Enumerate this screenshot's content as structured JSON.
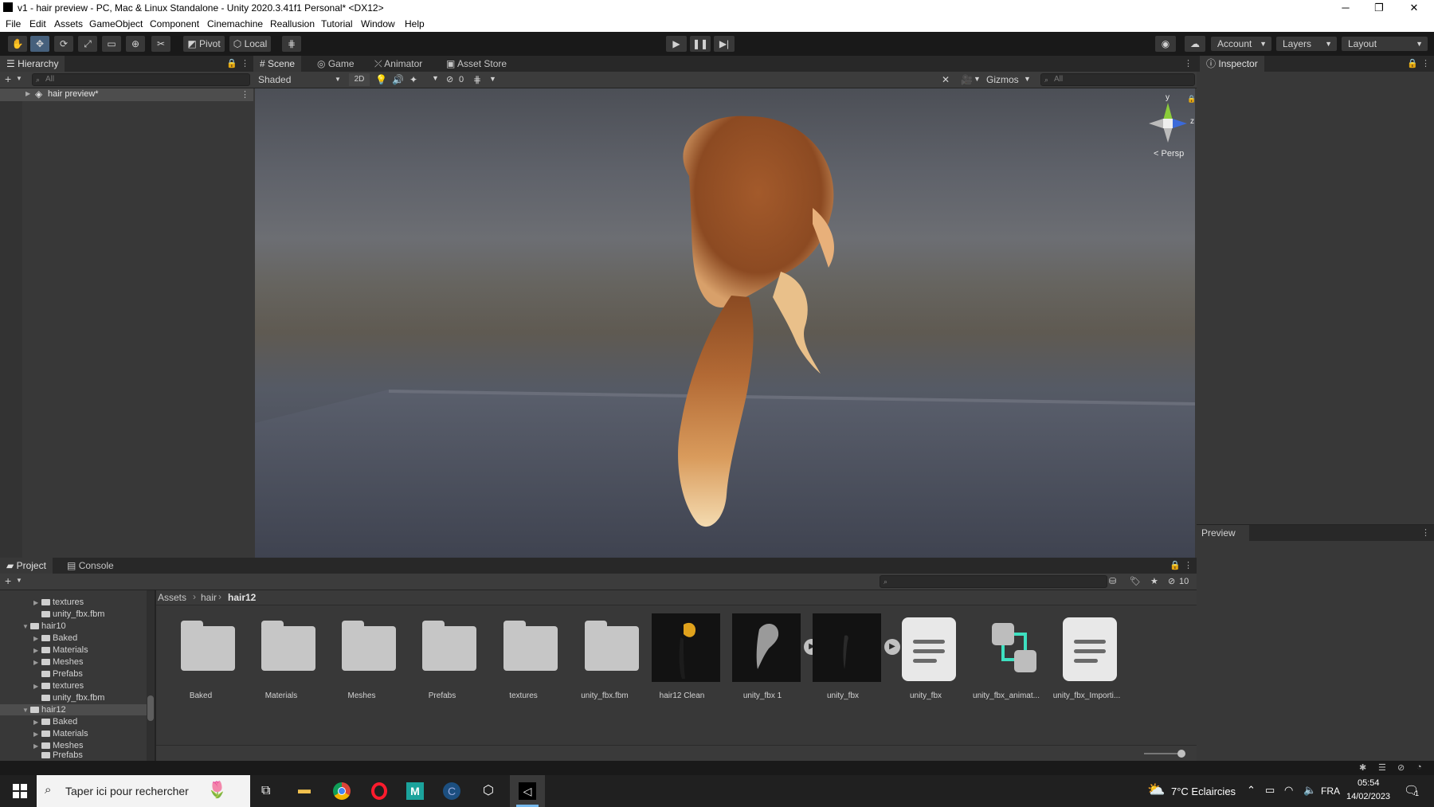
{
  "window": {
    "title": "v1 - hair preview - PC, Mac & Linux Standalone - Unity 2020.3.41f1 Personal* <DX12>",
    "minimize": "─",
    "restore": "❐",
    "close": "✕"
  },
  "menu": [
    "File",
    "Edit",
    "Assets",
    "GameObject",
    "Component",
    "Cinemachine",
    "Reallusion",
    "Tutorial",
    "Window",
    "Help"
  ],
  "toolbar": {
    "pivot_label": "Pivot",
    "local_label": "Local",
    "account_label": "Account",
    "layers_label": "Layers",
    "layout_label": "Layout"
  },
  "hierarchy": {
    "tab_label": "Hierarchy",
    "search_placeholder": "All",
    "root_item": "hair preview*"
  },
  "scene_tabs": {
    "scene": "Scene",
    "game": "Game",
    "animator": "Animator",
    "asset_store": "Asset Store"
  },
  "scene_toolbar": {
    "draw_mode": "Shaded",
    "mode_2d": "2D",
    "hidden_count": "0",
    "gizmos_label": "Gizmos",
    "search_placeholder": "All"
  },
  "gizmo": {
    "axis_y": "y",
    "axis_z": "z",
    "projection": "Persp"
  },
  "inspector": {
    "tab_label": "Inspector",
    "preview_label": "Preview"
  },
  "project": {
    "tab_project": "Project",
    "tab_console": "Console",
    "hidden_count": "10",
    "breadcrumb": [
      "Assets",
      "hair",
      "hair12"
    ],
    "tree": [
      {
        "label": "textures",
        "depth": 2,
        "arrow": true
      },
      {
        "label": "unity_fbx.fbm",
        "depth": 2,
        "arrow": false
      },
      {
        "label": "hair10",
        "depth": 1,
        "arrow": true,
        "open": true
      },
      {
        "label": "Baked",
        "depth": 2,
        "arrow": true
      },
      {
        "label": "Materials",
        "depth": 2,
        "arrow": true
      },
      {
        "label": "Meshes",
        "depth": 2,
        "arrow": true
      },
      {
        "label": "Prefabs",
        "depth": 2,
        "arrow": false
      },
      {
        "label": "textures",
        "depth": 2,
        "arrow": true
      },
      {
        "label": "unity_fbx.fbm",
        "depth": 2,
        "arrow": false
      },
      {
        "label": "hair12",
        "depth": 1,
        "arrow": true,
        "open": true,
        "selected": true
      },
      {
        "label": "Baked",
        "depth": 2,
        "arrow": true
      },
      {
        "label": "Materials",
        "depth": 2,
        "arrow": true
      },
      {
        "label": "Meshes",
        "depth": 2,
        "arrow": true
      },
      {
        "label": "Prefabs",
        "depth": 2,
        "arrow": false
      }
    ],
    "assets": [
      {
        "label": "Baked",
        "kind": "folder"
      },
      {
        "label": "Materials",
        "kind": "folder"
      },
      {
        "label": "Meshes",
        "kind": "folder"
      },
      {
        "label": "Prefabs",
        "kind": "folder"
      },
      {
        "label": "textures",
        "kind": "folder"
      },
      {
        "label": "unity_fbx.fbm",
        "kind": "folder"
      },
      {
        "label": "hair12 Clean",
        "kind": "model-blonde"
      },
      {
        "label": "unity_fbx 1",
        "kind": "model-grey"
      },
      {
        "label": "unity_fbx",
        "kind": "model-dark"
      },
      {
        "label": "unity_fbx",
        "kind": "doc"
      },
      {
        "label": "unity_fbx_animat...",
        "kind": "anim"
      },
      {
        "label": "unity_fbx_Importi...",
        "kind": "doc"
      }
    ]
  },
  "taskbar": {
    "search_placeholder": "Taper ici pour rechercher",
    "weather": "7°C  Eclaircies",
    "language": "FRA",
    "time": "05:54",
    "date": "14/02/2023",
    "notif_count": "1"
  },
  "colors": {
    "editor_dark": "#383838",
    "tab_dark": "#282828",
    "toolbar": "#191919",
    "accent_blue": "#46607c",
    "selection": "#4d4d4d",
    "taskbar": "#202020"
  }
}
